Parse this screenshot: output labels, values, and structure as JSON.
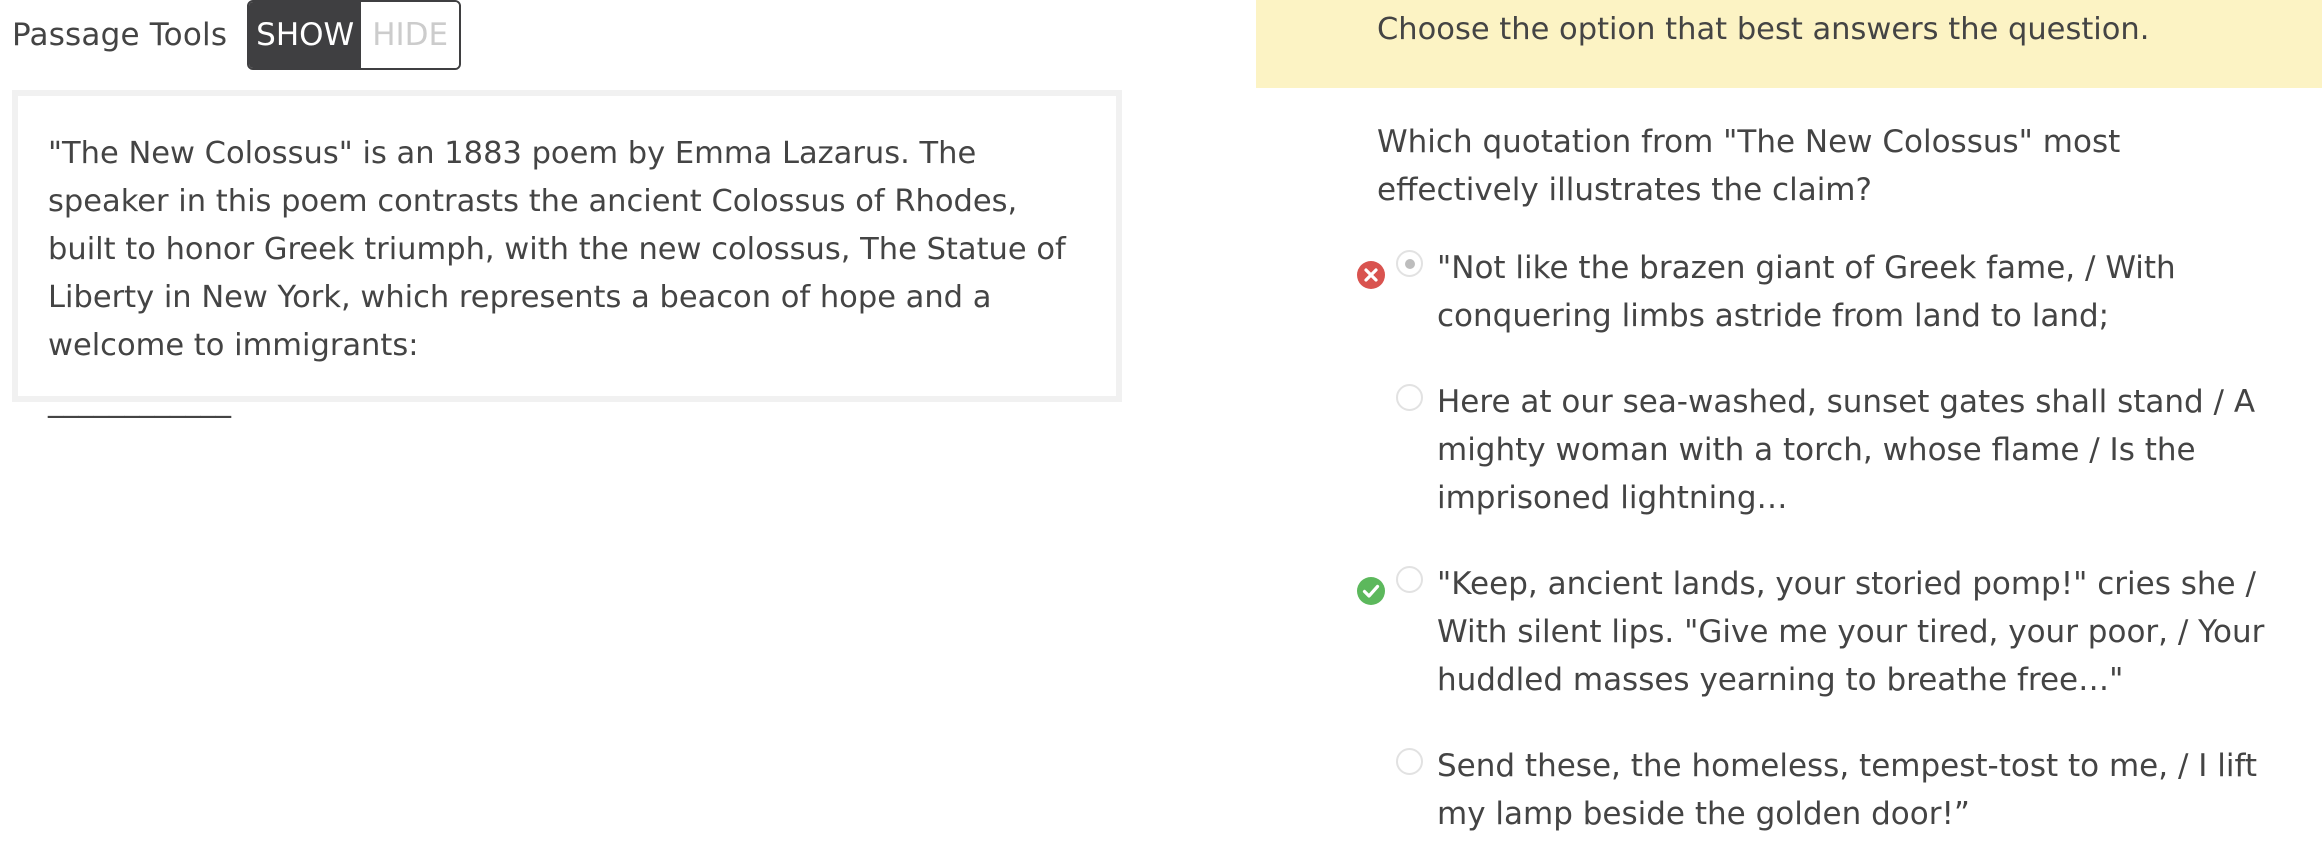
{
  "passage_tools": {
    "label": "Passage Tools",
    "show_label": "SHOW",
    "hide_label": "HIDE"
  },
  "passage": {
    "text": "\"The New Colossus\" is an 1883 poem by Emma Lazarus. The speaker in this poem contrasts the ancient Colossus of Rhodes, built to honor Greek triumph, with the new colossus, The Statue of Liberty in New York, which represents a beacon of hope and a welcome to immigrants:",
    "blank": "____________"
  },
  "instruction": "Choose the option that best answers the question.",
  "question": "Which quotation from \"The New Colossus\" most effectively illustrates the claim?",
  "options": [
    {
      "text": "\"Not like the brazen giant of Greek fame, / With conquering limbs astride from land to land;",
      "selected": true,
      "mark": "incorrect"
    },
    {
      "text": "Here at our sea-washed, sunset gates shall stand / A mighty woman with a torch, whose flame / Is the imprisoned lightning…",
      "selected": false,
      "mark": "none"
    },
    {
      "text": "\"Keep, ancient lands, your storied pomp!\" cries she / With silent lips. \"Give me your tired, your poor, / Your huddled masses yearning to breathe free…\"",
      "selected": false,
      "mark": "correct"
    },
    {
      "text": "Send these, the homeless, tempest-tost to me, / I lift my lamp beside the golden door!”",
      "selected": false,
      "mark": "none"
    }
  ],
  "icons": {
    "incorrect": "x-circle-icon",
    "correct": "check-circle-icon"
  },
  "colors": {
    "toggle_active": "#3f3f41",
    "instruction_bg": "#fcf3c4",
    "incorrect": "#d9534f",
    "correct": "#5cb85c"
  }
}
